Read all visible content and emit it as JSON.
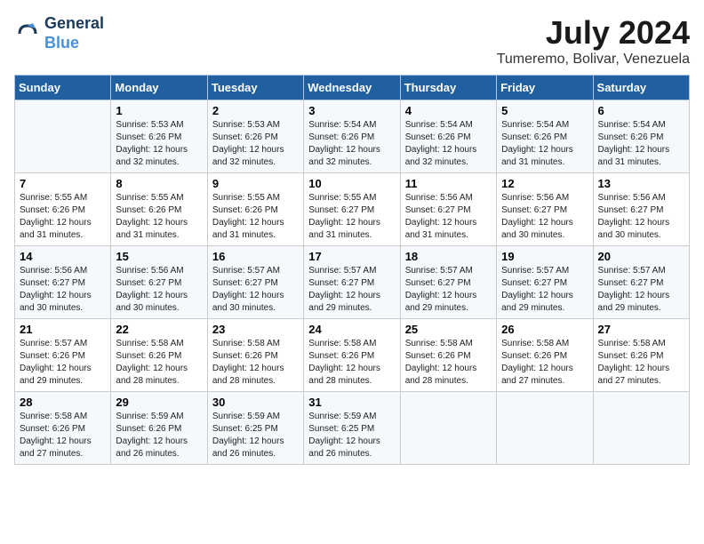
{
  "logo": {
    "line1": "General",
    "line2": "Blue"
  },
  "title": "July 2024",
  "subtitle": "Tumeremo, Bolivar, Venezuela",
  "days_of_week": [
    "Sunday",
    "Monday",
    "Tuesday",
    "Wednesday",
    "Thursday",
    "Friday",
    "Saturday"
  ],
  "weeks": [
    [
      {
        "day": "",
        "info": ""
      },
      {
        "day": "1",
        "info": "Sunrise: 5:53 AM\nSunset: 6:26 PM\nDaylight: 12 hours\nand 32 minutes."
      },
      {
        "day": "2",
        "info": "Sunrise: 5:53 AM\nSunset: 6:26 PM\nDaylight: 12 hours\nand 32 minutes."
      },
      {
        "day": "3",
        "info": "Sunrise: 5:54 AM\nSunset: 6:26 PM\nDaylight: 12 hours\nand 32 minutes."
      },
      {
        "day": "4",
        "info": "Sunrise: 5:54 AM\nSunset: 6:26 PM\nDaylight: 12 hours\nand 32 minutes."
      },
      {
        "day": "5",
        "info": "Sunrise: 5:54 AM\nSunset: 6:26 PM\nDaylight: 12 hours\nand 31 minutes."
      },
      {
        "day": "6",
        "info": "Sunrise: 5:54 AM\nSunset: 6:26 PM\nDaylight: 12 hours\nand 31 minutes."
      }
    ],
    [
      {
        "day": "7",
        "info": "Sunrise: 5:55 AM\nSunset: 6:26 PM\nDaylight: 12 hours\nand 31 minutes."
      },
      {
        "day": "8",
        "info": "Sunrise: 5:55 AM\nSunset: 6:26 PM\nDaylight: 12 hours\nand 31 minutes."
      },
      {
        "day": "9",
        "info": "Sunrise: 5:55 AM\nSunset: 6:26 PM\nDaylight: 12 hours\nand 31 minutes."
      },
      {
        "day": "10",
        "info": "Sunrise: 5:55 AM\nSunset: 6:27 PM\nDaylight: 12 hours\nand 31 minutes."
      },
      {
        "day": "11",
        "info": "Sunrise: 5:56 AM\nSunset: 6:27 PM\nDaylight: 12 hours\nand 31 minutes."
      },
      {
        "day": "12",
        "info": "Sunrise: 5:56 AM\nSunset: 6:27 PM\nDaylight: 12 hours\nand 30 minutes."
      },
      {
        "day": "13",
        "info": "Sunrise: 5:56 AM\nSunset: 6:27 PM\nDaylight: 12 hours\nand 30 minutes."
      }
    ],
    [
      {
        "day": "14",
        "info": "Sunrise: 5:56 AM\nSunset: 6:27 PM\nDaylight: 12 hours\nand 30 minutes."
      },
      {
        "day": "15",
        "info": "Sunrise: 5:56 AM\nSunset: 6:27 PM\nDaylight: 12 hours\nand 30 minutes."
      },
      {
        "day": "16",
        "info": "Sunrise: 5:57 AM\nSunset: 6:27 PM\nDaylight: 12 hours\nand 30 minutes."
      },
      {
        "day": "17",
        "info": "Sunrise: 5:57 AM\nSunset: 6:27 PM\nDaylight: 12 hours\nand 29 minutes."
      },
      {
        "day": "18",
        "info": "Sunrise: 5:57 AM\nSunset: 6:27 PM\nDaylight: 12 hours\nand 29 minutes."
      },
      {
        "day": "19",
        "info": "Sunrise: 5:57 AM\nSunset: 6:27 PM\nDaylight: 12 hours\nand 29 minutes."
      },
      {
        "day": "20",
        "info": "Sunrise: 5:57 AM\nSunset: 6:27 PM\nDaylight: 12 hours\nand 29 minutes."
      }
    ],
    [
      {
        "day": "21",
        "info": "Sunrise: 5:57 AM\nSunset: 6:26 PM\nDaylight: 12 hours\nand 29 minutes."
      },
      {
        "day": "22",
        "info": "Sunrise: 5:58 AM\nSunset: 6:26 PM\nDaylight: 12 hours\nand 28 minutes."
      },
      {
        "day": "23",
        "info": "Sunrise: 5:58 AM\nSunset: 6:26 PM\nDaylight: 12 hours\nand 28 minutes."
      },
      {
        "day": "24",
        "info": "Sunrise: 5:58 AM\nSunset: 6:26 PM\nDaylight: 12 hours\nand 28 minutes."
      },
      {
        "day": "25",
        "info": "Sunrise: 5:58 AM\nSunset: 6:26 PM\nDaylight: 12 hours\nand 28 minutes."
      },
      {
        "day": "26",
        "info": "Sunrise: 5:58 AM\nSunset: 6:26 PM\nDaylight: 12 hours\nand 27 minutes."
      },
      {
        "day": "27",
        "info": "Sunrise: 5:58 AM\nSunset: 6:26 PM\nDaylight: 12 hours\nand 27 minutes."
      }
    ],
    [
      {
        "day": "28",
        "info": "Sunrise: 5:58 AM\nSunset: 6:26 PM\nDaylight: 12 hours\nand 27 minutes."
      },
      {
        "day": "29",
        "info": "Sunrise: 5:59 AM\nSunset: 6:26 PM\nDaylight: 12 hours\nand 26 minutes."
      },
      {
        "day": "30",
        "info": "Sunrise: 5:59 AM\nSunset: 6:25 PM\nDaylight: 12 hours\nand 26 minutes."
      },
      {
        "day": "31",
        "info": "Sunrise: 5:59 AM\nSunset: 6:25 PM\nDaylight: 12 hours\nand 26 minutes."
      },
      {
        "day": "",
        "info": ""
      },
      {
        "day": "",
        "info": ""
      },
      {
        "day": "",
        "info": ""
      }
    ]
  ]
}
